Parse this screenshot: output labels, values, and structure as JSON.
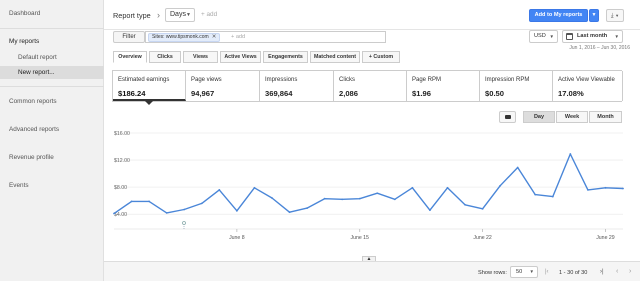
{
  "sidebar": {
    "items": [
      {
        "label": "Dashboard"
      },
      {
        "label": "My reports"
      },
      {
        "label": "Default report"
      },
      {
        "label": "New report..."
      },
      {
        "label": "Common reports"
      },
      {
        "label": "Advanced reports"
      },
      {
        "label": "Revenue profile"
      },
      {
        "label": "Events"
      }
    ]
  },
  "header": {
    "report_type": "Report type",
    "dimension": "Days",
    "add_label": "+ add",
    "add_button": "Add to My reports",
    "download_icon": "⤓"
  },
  "filter": {
    "button": "Filter",
    "chip": "Sites: www.tipsmonk.com",
    "add_label": "+ add",
    "currency": "USD",
    "period": "Last month",
    "date_range": "Jun 1, 2016 – Jun 30, 2016"
  },
  "tabs": [
    {
      "label": "Overview"
    },
    {
      "label": "Clicks"
    },
    {
      "label": "Views"
    },
    {
      "label": "Active Views"
    },
    {
      "label": "Engagements"
    },
    {
      "label": "Matched content"
    },
    {
      "label": "+ Custom"
    }
  ],
  "metrics": [
    {
      "label": "Estimated earnings",
      "value": "$186.24"
    },
    {
      "label": "Page views",
      "value": "94,967"
    },
    {
      "label": "Impressions",
      "value": "369,864"
    },
    {
      "label": "Clicks",
      "value": "2,086"
    },
    {
      "label": "Page RPM",
      "value": "$1.96"
    },
    {
      "label": "Impression RPM",
      "value": "$0.50"
    },
    {
      "label": "Active View Viewable",
      "value": "17.08%"
    }
  ],
  "chart_controls": {
    "day": "Day",
    "week": "Week",
    "month": "Month"
  },
  "chart_data": {
    "type": "line",
    "x": [
      "Jun 1",
      "Jun 2",
      "Jun 3",
      "Jun 4",
      "Jun 5",
      "Jun 6",
      "Jun 7",
      "Jun 8",
      "Jun 9",
      "Jun 10",
      "Jun 11",
      "Jun 12",
      "Jun 13",
      "Jun 14",
      "Jun 15",
      "Jun 16",
      "Jun 17",
      "Jun 18",
      "Jun 19",
      "Jun 20",
      "Jun 21",
      "Jun 22",
      "Jun 23",
      "Jun 24",
      "Jun 25",
      "Jun 26",
      "Jun 27",
      "Jun 28",
      "Jun 29",
      "Jun 30"
    ],
    "series": [
      {
        "values": [
          4.1,
          5.9,
          5.9,
          4.2,
          4.7,
          5.6,
          7.6,
          4.5,
          7.9,
          6.4,
          4.3,
          4.9,
          6.3,
          6.2,
          6.3,
          7.1,
          6.2,
          7.9,
          4.6,
          7.9,
          5.4,
          4.8,
          8.2,
          10.9,
          6.9,
          6.6,
          12.9,
          7.6,
          7.9,
          7.8
        ]
      }
    ],
    "y_ticks": [
      "$4.00",
      "$8.00",
      "$12.00",
      "$16.00"
    ],
    "y_tick_values": [
      4,
      8,
      12,
      16
    ],
    "x_ticks": [
      "June 8",
      "June 15",
      "June 22",
      "June 29"
    ],
    "ylim": [
      3,
      16
    ],
    "color": "#4a86d8",
    "grid": true
  },
  "table_footer": {
    "show_rows": "Show rows:",
    "rows": "50",
    "page_info": "1 - 30 of 30"
  }
}
